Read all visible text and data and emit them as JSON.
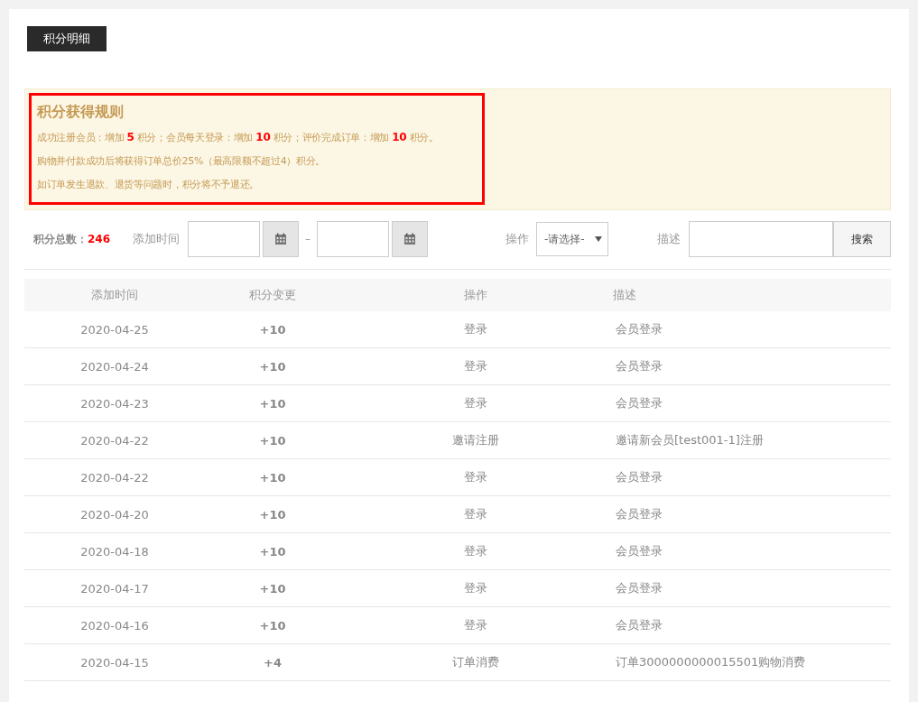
{
  "tab": {
    "label": "积分明细"
  },
  "rules": {
    "title": "积分获得规则",
    "lines": [
      "成功注册会员：增加 **5** 积分；会员每天登录：增加 **10** 积分；评价完成订单：增加 **10** 积分。",
      "购物并付款成功后将获得订单总价25%（最高限额不超过4）积分。",
      "如订单发生退款、退货等问题时，积分将不予退还。"
    ]
  },
  "filter": {
    "total_label": "积分总数：",
    "total_value": "246",
    "time_label": "添加时间",
    "separator": "–",
    "op_label": "操作",
    "op_select": "-请选择-",
    "desc_label": "描述",
    "search_button": "搜索"
  },
  "table": {
    "columns": [
      "添加时间",
      "积分变更",
      "操作",
      "描述"
    ],
    "rows": [
      {
        "date": "2020-04-25",
        "change": "+10",
        "operation": "登录",
        "description": "会员登录"
      },
      {
        "date": "2020-04-24",
        "change": "+10",
        "operation": "登录",
        "description": "会员登录"
      },
      {
        "date": "2020-04-23",
        "change": "+10",
        "operation": "登录",
        "description": "会员登录"
      },
      {
        "date": "2020-04-22",
        "change": "+10",
        "operation": "邀请注册",
        "description": "邀请新会员[test001-1]注册"
      },
      {
        "date": "2020-04-22",
        "change": "+10",
        "operation": "登录",
        "description": "会员登录"
      },
      {
        "date": "2020-04-20",
        "change": "+10",
        "operation": "登录",
        "description": "会员登录"
      },
      {
        "date": "2020-04-18",
        "change": "+10",
        "operation": "登录",
        "description": "会员登录"
      },
      {
        "date": "2020-04-17",
        "change": "+10",
        "operation": "登录",
        "description": "会员登录"
      },
      {
        "date": "2020-04-16",
        "change": "+10",
        "operation": "登录",
        "description": "会员登录"
      },
      {
        "date": "2020-04-15",
        "change": "+4",
        "operation": "订单消费",
        "description": "订单3000000000015501购物消费"
      }
    ]
  }
}
